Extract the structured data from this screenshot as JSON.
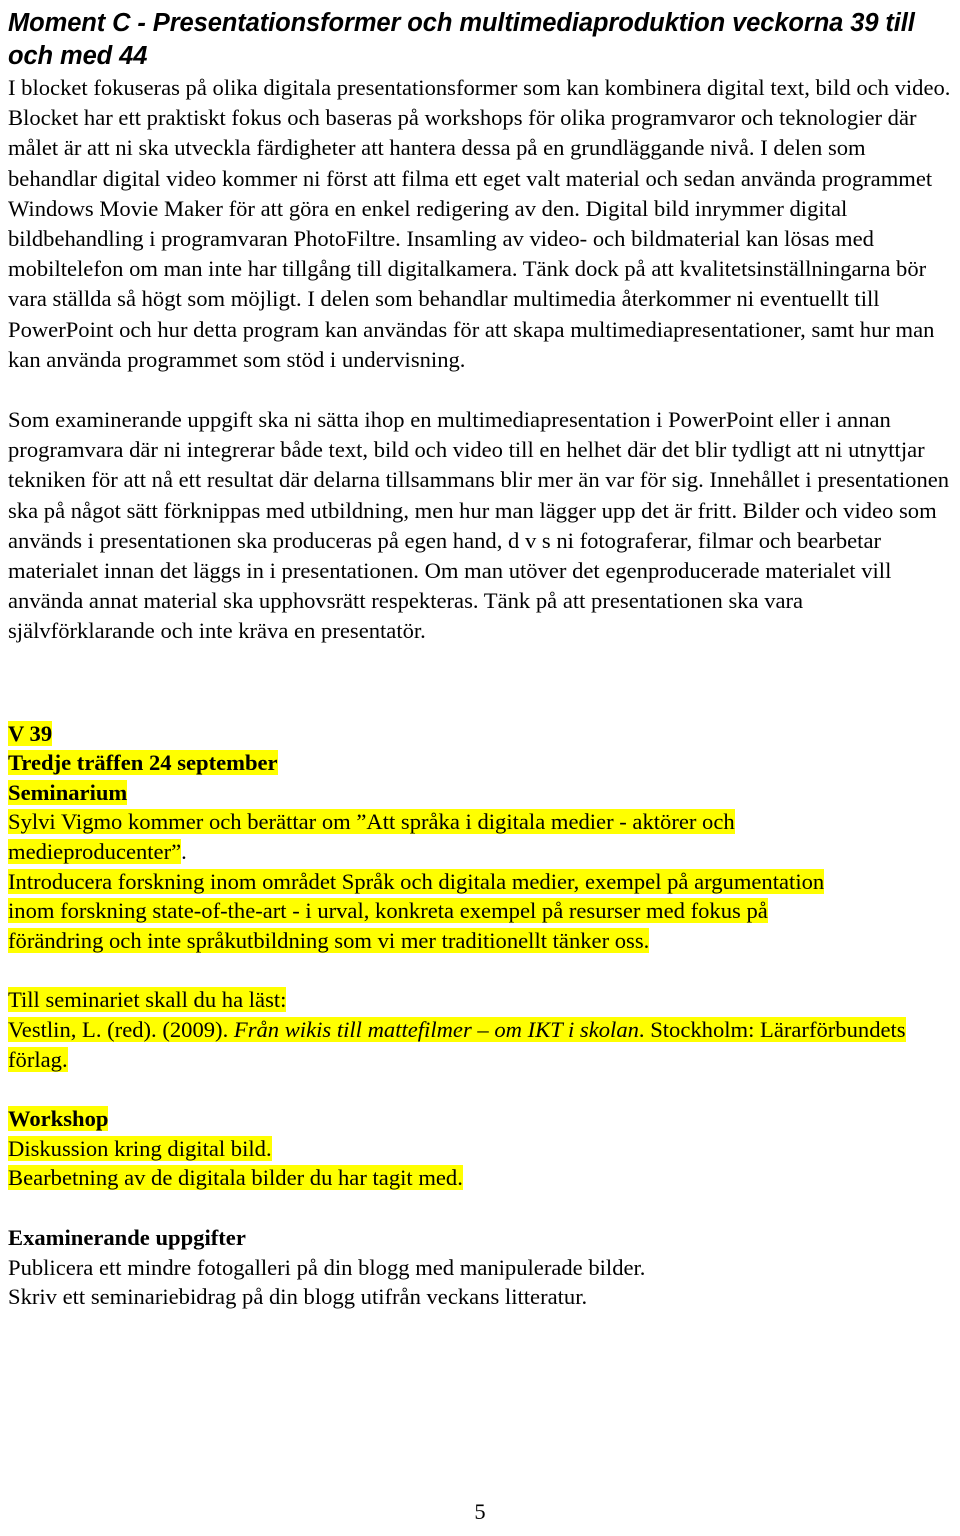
{
  "document": {
    "title_line_1": "Moment C - Presentationsformer och multimediaproduktion",
    "title_line_2": "veckorna 39 till och med 44",
    "page_number": "5",
    "highlight_color": "#FFFF00",
    "text_color": "#000000",
    "background_color": "#FFFFFF"
  },
  "intro": {
    "lines": [
      "I blocket fokuseras på olika digitala presentationsformer som kan kombinera digital text, bild",
      "och video.  Blocket har ett praktiskt fokus och baseras på workshops för olika programvaror",
      "och teknologier där målet är att ni ska utveckla färdigheter att hantera dessa på en",
      "grundläggande nivå.  I delen som behandlar digital video kommer ni först att filma ett eget",
      "valt material och sedan använda programmet Windows Movie Maker för att göra en enkel",
      "redigering av den. Digital bild inrymmer digital bildbehandling i programvaran PhotoFiltre.",
      "Insamling av video- och bildmaterial kan lösas med mobiltelefon om man inte har tillgång till",
      "digitalkamera. Tänk dock på att kvalitetsinställningarna bör vara ställda så högt som möjligt. I",
      "delen som behandlar multimedia återkommer ni eventuellt till PowerPoint och hur detta",
      "program kan användas för att skapa multimediapresentationer, samt hur man kan använda",
      "programmet som stöd i undervisning."
    ]
  },
  "assignment": {
    "lines": [
      "Som examinerande uppgift ska ni sätta ihop en multimediapresentation i PowerPoint eller i",
      "annan programvara där ni integrerar både text, bild och video till en helhet där det blir tydligt",
      "att ni utnyttjar tekniken för att nå ett resultat där delarna tillsammans blir mer än var för sig.",
      "Innehållet i presentationen ska på något sätt förknippas med utbildning, men hur man lägger",
      "upp det är fritt. Bilder och video som används i presentationen ska produceras på egen hand,",
      "d v s ni fotograferar, filmar och bearbetar materialet innan det läggs in i presentationen. Om",
      "man utöver det egenproducerade materialet vill använda annat material ska upphovsrätt",
      "respekteras. Tänk på att presentationen ska vara självförklarande och inte kräva en",
      "presentatör."
    ]
  },
  "week_39": {
    "week_label": "V 39",
    "meeting_label": "Tredje träffen 24 september",
    "seminar_label": "Seminarium",
    "seminar_lines": [
      "Sylvi Vigmo kommer och berättar om ”Att språka i digitala medier - aktörer och",
      "medieproducenter”"
    ],
    "seminar_trailing_period": ".",
    "description_lines": [
      "Introducera forskning inom området Språk och digitala medier, exempel på argumentation",
      "inom forskning state-of-the-art - i urval, konkreta exempel på resurser med fokus på",
      "förändring och inte språkutbildning som vi mer traditionellt tänker oss."
    ]
  },
  "reading": {
    "heading": "Till seminariet skall du ha läst:",
    "citation_prefix": "Vestlin, L. (red). (2009). ",
    "citation_italic": "Från wikis till mattefilmer – om IKT i skolan",
    "citation_suffix": ". Stockholm: Lärarförbundets",
    "citation_line_2": "förlag."
  },
  "workshop": {
    "heading": "Workshop",
    "lines": [
      "Diskussion kring digital bild.",
      "Bearbetning av de digitala bilder du har tagit med."
    ]
  },
  "examination": {
    "heading": "Examinerande uppgifter",
    "lines": [
      "Publicera ett mindre fotogalleri på din blogg med manipulerade bilder.",
      "Skriv ett seminariebidrag på din blogg utifrån veckans litteratur."
    ]
  }
}
